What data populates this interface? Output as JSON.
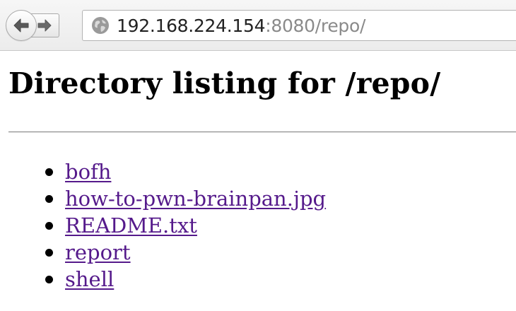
{
  "browser": {
    "url_host": "192.168.224.154",
    "url_rest": ":8080/repo/",
    "icons": {
      "back": "back-arrow-icon",
      "forward": "forward-arrow-icon",
      "site": "globe-icon"
    }
  },
  "page": {
    "title": "Directory listing for /repo/",
    "files": [
      {
        "name": "bofh"
      },
      {
        "name": "how-to-pwn-brainpan.jpg"
      },
      {
        "name": "README.txt"
      },
      {
        "name": "report"
      },
      {
        "name": "shell"
      }
    ],
    "link_color": "#551a8b"
  }
}
